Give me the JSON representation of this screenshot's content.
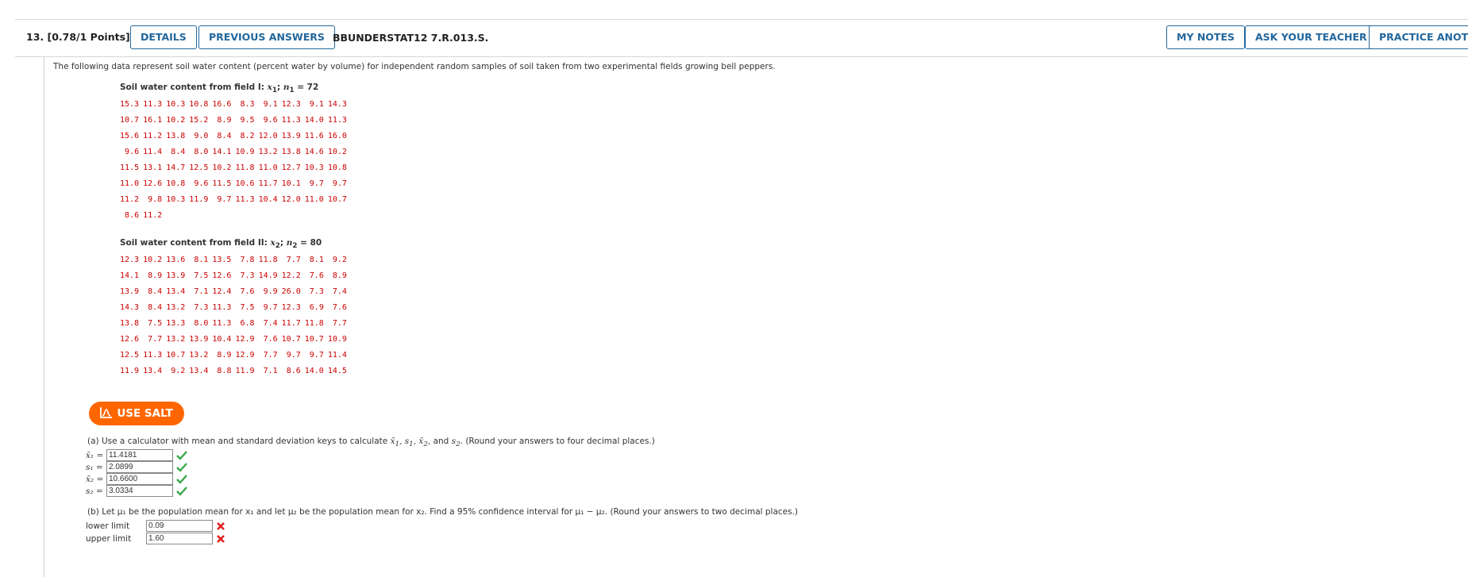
{
  "header": {
    "question_number": "13. [0.78/1 Points]",
    "details_label": "DETAILS",
    "previous_answers_label": "PREVIOUS ANSWERS",
    "question_code": "BBUNDERSTAT12 7.R.013.S.",
    "my_notes_label": "MY NOTES",
    "ask_teacher_label": "ASK YOUR TEACHER",
    "practice_label": "PRACTICE ANOTHER"
  },
  "intro": "The following data represent soil water content (percent water by volume) for independent random samples of soil taken from two experimental fields growing bell peppers.",
  "field1": {
    "title_prefix": "Soil water content from field I: ",
    "var": "x",
    "sub": "1",
    "n_label": "n",
    "n_value": "72",
    "rows": [
      [
        "15.3",
        "11.3",
        "10.3",
        "10.8",
        "16.6",
        "8.3",
        "9.1",
        "12.3",
        "9.1",
        "14.3"
      ],
      [
        "10.7",
        "16.1",
        "10.2",
        "15.2",
        "8.9",
        "9.5",
        "9.6",
        "11.3",
        "14.0",
        "11.3"
      ],
      [
        "15.6",
        "11.2",
        "13.8",
        "9.0",
        "8.4",
        "8.2",
        "12.0",
        "13.9",
        "11.6",
        "16.0"
      ],
      [
        "9.6",
        "11.4",
        "8.4",
        "8.0",
        "14.1",
        "10.9",
        "13.2",
        "13.8",
        "14.6",
        "10.2"
      ],
      [
        "11.5",
        "13.1",
        "14.7",
        "12.5",
        "10.2",
        "11.8",
        "11.0",
        "12.7",
        "10.3",
        "10.8"
      ],
      [
        "11.0",
        "12.6",
        "10.8",
        "9.6",
        "11.5",
        "10.6",
        "11.7",
        "10.1",
        "9.7",
        "9.7"
      ],
      [
        "11.2",
        "9.8",
        "10.3",
        "11.9",
        "9.7",
        "11.3",
        "10.4",
        "12.0",
        "11.0",
        "10.7"
      ],
      [
        "8.6",
        "11.2",
        "",
        "",
        "",
        "",
        "",
        "",
        "",
        ""
      ]
    ]
  },
  "field2": {
    "title_prefix": "Soil water content from field II: ",
    "var": "x",
    "sub": "2",
    "n_label": "n",
    "n_value": "80",
    "rows": [
      [
        "12.3",
        "10.2",
        "13.6",
        "8.1",
        "13.5",
        "7.8",
        "11.8",
        "7.7",
        "8.1",
        "9.2"
      ],
      [
        "14.1",
        "8.9",
        "13.9",
        "7.5",
        "12.6",
        "7.3",
        "14.9",
        "12.2",
        "7.6",
        "8.9"
      ],
      [
        "13.9",
        "8.4",
        "13.4",
        "7.1",
        "12.4",
        "7.6",
        "9.9",
        "26.0",
        "7.3",
        "7.4"
      ],
      [
        "14.3",
        "8.4",
        "13.2",
        "7.3",
        "11.3",
        "7.5",
        "9.7",
        "12.3",
        "6.9",
        "7.6"
      ],
      [
        "13.8",
        "7.5",
        "13.3",
        "8.0",
        "11.3",
        "6.8",
        "7.4",
        "11.7",
        "11.8",
        "7.7"
      ],
      [
        "12.6",
        "7.7",
        "13.2",
        "13.9",
        "10.4",
        "12.9",
        "7.6",
        "10.7",
        "10.7",
        "10.9"
      ],
      [
        "12.5",
        "11.3",
        "10.7",
        "13.2",
        "8.9",
        "12.9",
        "7.7",
        "9.7",
        "9.7",
        "11.4"
      ],
      [
        "11.9",
        "13.4",
        "9.2",
        "13.4",
        "8.8",
        "11.9",
        "7.1",
        "8.6",
        "14.0",
        "14.5"
      ]
    ]
  },
  "salt_label": "USE SALT",
  "part_a": {
    "text_before": "(a) Use a calculator with mean and standard deviation keys to calculate ",
    "text_after": ". (Round your answers to four decimal places.)",
    "answers": [
      {
        "label": "x̄₁ =",
        "value": "11.4181"
      },
      {
        "label": "s₁ =",
        "value": "2.0899"
      },
      {
        "label": "x̄₂ =",
        "value": "10.6600"
      },
      {
        "label": "s₂ =",
        "value": "3.0334"
      }
    ]
  },
  "part_b": {
    "text": "(b) Let μ₁ be the population mean for x₁ and let μ₂ be the population mean for x₂. Find a 95% confidence interval for μ₁ − μ₂. (Round your answers to two decimal places.)",
    "lower_label": "lower limit",
    "lower_value": "0.09",
    "upper_label": "upper limit",
    "upper_value": "1.60"
  },
  "colors": {
    "accent": "#22679c",
    "data_red": "#cc0000",
    "salt_orange": "#ff6600",
    "correct_green": "#3aa84a",
    "wrong_red": "#e02020"
  }
}
